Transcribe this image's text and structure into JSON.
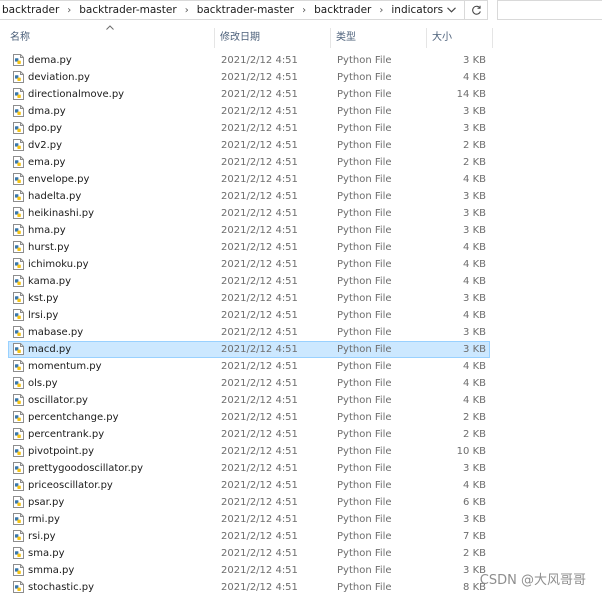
{
  "address_bar": {
    "breadcrumbs": [
      "backtrader",
      "backtrader-master",
      "backtrader-master",
      "backtrader",
      "indicators"
    ]
  },
  "columns": {
    "name": "名称",
    "date": "修改日期",
    "type": "类型",
    "size": "大小"
  },
  "icons": {
    "file": "python-file-icon",
    "dropdown": "chevron-down-icon",
    "refresh": "refresh-icon",
    "sort": "sort-ascending-icon"
  },
  "colors": {
    "selection_bg": "#cce8ff",
    "selection_border": "#99d1ff",
    "header_text": "#4c607a"
  },
  "selected_index": 17,
  "files": [
    {
      "name": "dema.py",
      "date": "2021/2/12 4:51",
      "type": "Python File",
      "size": "3 KB"
    },
    {
      "name": "deviation.py",
      "date": "2021/2/12 4:51",
      "type": "Python File",
      "size": "4 KB"
    },
    {
      "name": "directionalmove.py",
      "date": "2021/2/12 4:51",
      "type": "Python File",
      "size": "14 KB"
    },
    {
      "name": "dma.py",
      "date": "2021/2/12 4:51",
      "type": "Python File",
      "size": "3 KB"
    },
    {
      "name": "dpo.py",
      "date": "2021/2/12 4:51",
      "type": "Python File",
      "size": "3 KB"
    },
    {
      "name": "dv2.py",
      "date": "2021/2/12 4:51",
      "type": "Python File",
      "size": "2 KB"
    },
    {
      "name": "ema.py",
      "date": "2021/2/12 4:51",
      "type": "Python File",
      "size": "2 KB"
    },
    {
      "name": "envelope.py",
      "date": "2021/2/12 4:51",
      "type": "Python File",
      "size": "4 KB"
    },
    {
      "name": "hadelta.py",
      "date": "2021/2/12 4:51",
      "type": "Python File",
      "size": "3 KB"
    },
    {
      "name": "heikinashi.py",
      "date": "2021/2/12 4:51",
      "type": "Python File",
      "size": "3 KB"
    },
    {
      "name": "hma.py",
      "date": "2021/2/12 4:51",
      "type": "Python File",
      "size": "3 KB"
    },
    {
      "name": "hurst.py",
      "date": "2021/2/12 4:51",
      "type": "Python File",
      "size": "4 KB"
    },
    {
      "name": "ichimoku.py",
      "date": "2021/2/12 4:51",
      "type": "Python File",
      "size": "4 KB"
    },
    {
      "name": "kama.py",
      "date": "2021/2/12 4:51",
      "type": "Python File",
      "size": "4 KB"
    },
    {
      "name": "kst.py",
      "date": "2021/2/12 4:51",
      "type": "Python File",
      "size": "3 KB"
    },
    {
      "name": "lrsi.py",
      "date": "2021/2/12 4:51",
      "type": "Python File",
      "size": "4 KB"
    },
    {
      "name": "mabase.py",
      "date": "2021/2/12 4:51",
      "type": "Python File",
      "size": "3 KB"
    },
    {
      "name": "macd.py",
      "date": "2021/2/12 4:51",
      "type": "Python File",
      "size": "3 KB"
    },
    {
      "name": "momentum.py",
      "date": "2021/2/12 4:51",
      "type": "Python File",
      "size": "4 KB"
    },
    {
      "name": "ols.py",
      "date": "2021/2/12 4:51",
      "type": "Python File",
      "size": "4 KB"
    },
    {
      "name": "oscillator.py",
      "date": "2021/2/12 4:51",
      "type": "Python File",
      "size": "4 KB"
    },
    {
      "name": "percentchange.py",
      "date": "2021/2/12 4:51",
      "type": "Python File",
      "size": "2 KB"
    },
    {
      "name": "percentrank.py",
      "date": "2021/2/12 4:51",
      "type": "Python File",
      "size": "2 KB"
    },
    {
      "name": "pivotpoint.py",
      "date": "2021/2/12 4:51",
      "type": "Python File",
      "size": "10 KB"
    },
    {
      "name": "prettygoodoscillator.py",
      "date": "2021/2/12 4:51",
      "type": "Python File",
      "size": "3 KB"
    },
    {
      "name": "priceoscillator.py",
      "date": "2021/2/12 4:51",
      "type": "Python File",
      "size": "4 KB"
    },
    {
      "name": "psar.py",
      "date": "2021/2/12 4:51",
      "type": "Python File",
      "size": "6 KB"
    },
    {
      "name": "rmi.py",
      "date": "2021/2/12 4:51",
      "type": "Python File",
      "size": "3 KB"
    },
    {
      "name": "rsi.py",
      "date": "2021/2/12 4:51",
      "type": "Python File",
      "size": "7 KB"
    },
    {
      "name": "sma.py",
      "date": "2021/2/12 4:51",
      "type": "Python File",
      "size": "2 KB"
    },
    {
      "name": "smma.py",
      "date": "2021/2/12 4:51",
      "type": "Python File",
      "size": "3 KB"
    },
    {
      "name": "stochastic.py",
      "date": "2021/2/12 4:51",
      "type": "Python File",
      "size": "8 KB"
    }
  ],
  "watermark": "CSDN @大风哥哥"
}
